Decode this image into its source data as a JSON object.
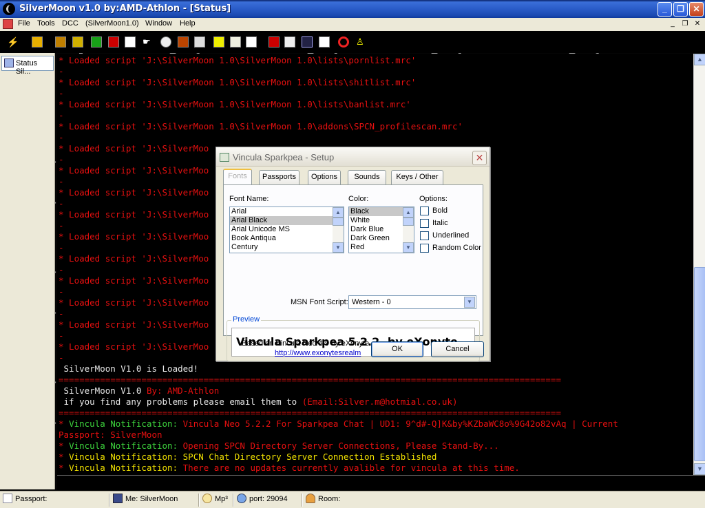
{
  "window": {
    "title": "SilverMoon v1.0 by:AMD-Athlon - [Status]"
  },
  "menu": [
    "File",
    "Tools",
    "DCC",
    "(SilverMoon1.0)",
    "Window",
    "Help"
  ],
  "toolbar_icons": [
    "connect-icon",
    "options-icon",
    "address-book-icon",
    "channels-icon",
    "scripts-editor-icon",
    "colors-icon",
    "notify-icon",
    "timer-icon",
    "dcc-send-icon",
    "dcc-chat-icon",
    "log-icon",
    "channel-list-icon",
    "tile-icon",
    "cascade-icon",
    "arrange-icon",
    "help-icon",
    "about-icon"
  ],
  "switchbar": {
    "status_tab": "Status Sil..."
  },
  "log": {
    "scripts": [
      "* Loaded script 'J:\\SilverMoon 1.0\\SilverMoon 1.0\\lists\\pornlist.mrc'",
      "* Loaded script 'J:\\SilverMoon 1.0\\SilverMoon 1.0\\lists\\shitlist.mrc'",
      "* Loaded script 'J:\\SilverMoon 1.0\\SilverMoon 1.0\\lists\\banlist.mrc'",
      "* Loaded script 'J:\\SilverMoon 1.0\\SilverMoon 1.0\\addons\\SPCN_profilescan.mrc'",
      "* Loaded script 'J:\\SilverMoo",
      "* Loaded script 'J:\\SilverMoo",
      "* Loaded script 'J:\\SilverMoo",
      "* Loaded script 'J:\\SilverMoo",
      "* Loaded script 'J:\\SilverMoo",
      "* Loaded script 'J:\\SilverMoo",
      "* Loaded script 'J:\\SilverMoo",
      "* Loaded script 'J:\\SilverMoo",
      "* Loaded script 'J:\\SilverMoo",
      "* Loaded script 'J:\\SilverMoo"
    ],
    "dash": "-",
    "loaded": " SilverMoon V1.0 is Loaded!",
    "separator": "=================================================================================================",
    "name_line_a": " SilverMoon V1.0 ",
    "name_line_b": "By: AMD-Athlon",
    "email_line_a": " if you find any problems please email them to ",
    "email_line_b": "(Email:Silver.m@hotmial.co.uk)",
    "notif_star": "* ",
    "notif_label": "Vincula Notification: ",
    "notif1_text": "Vincula Neo 5.2.2 For Sparkpea Chat | UD1: 9^d#-Q]K&by%KZbaWC8o%9G42o82vAq | Current",
    "notif1_cont": "Passport: SilverMoon",
    "notif2_text": "Opening SPCN Directory Server Connections, Please Stand-By...",
    "notif3_text": "SPCN Chat Directory Server Connection Established",
    "notif4_text": "There are no updates currently avalible for vincula at this time."
  },
  "statusbar": {
    "passport": "Passport:",
    "me": "Me: SilverMoon",
    "mp3": "Mp³",
    "port": "port: 29094",
    "room": "Room:"
  },
  "dialog": {
    "title": "Vincula Sparkpea - Setup",
    "tabs": [
      "Fonts",
      "Passports",
      "Options",
      "Sounds",
      "Keys / Other"
    ],
    "font_name_label": "Font Name:",
    "fonts": [
      "Arial",
      "Arial Black",
      "Arial Unicode MS",
      "Book Antiqua",
      "Century"
    ],
    "selected_font": "Arial Black",
    "color_label": "Color:",
    "colors": [
      "Black",
      "White",
      "Dark Blue",
      "Dark Green",
      "Red"
    ],
    "selected_color": "Black",
    "options_label": "Options:",
    "options": [
      "Bold",
      "Italic",
      "Underlined",
      "Random Color"
    ],
    "msn_script_label": "MSN Font Script:",
    "msn_script_value": "Western - 0",
    "preview_label": "Preview",
    "preview_text": "Vincula Sparkpea 5.2.2, by eXonyte",
    "footer_text": "Based on Vincula Neo 4.9 by eXonyte",
    "footer_link": "http://www.exonytesrealm",
    "ok": "OK",
    "cancel": "Cancel"
  }
}
